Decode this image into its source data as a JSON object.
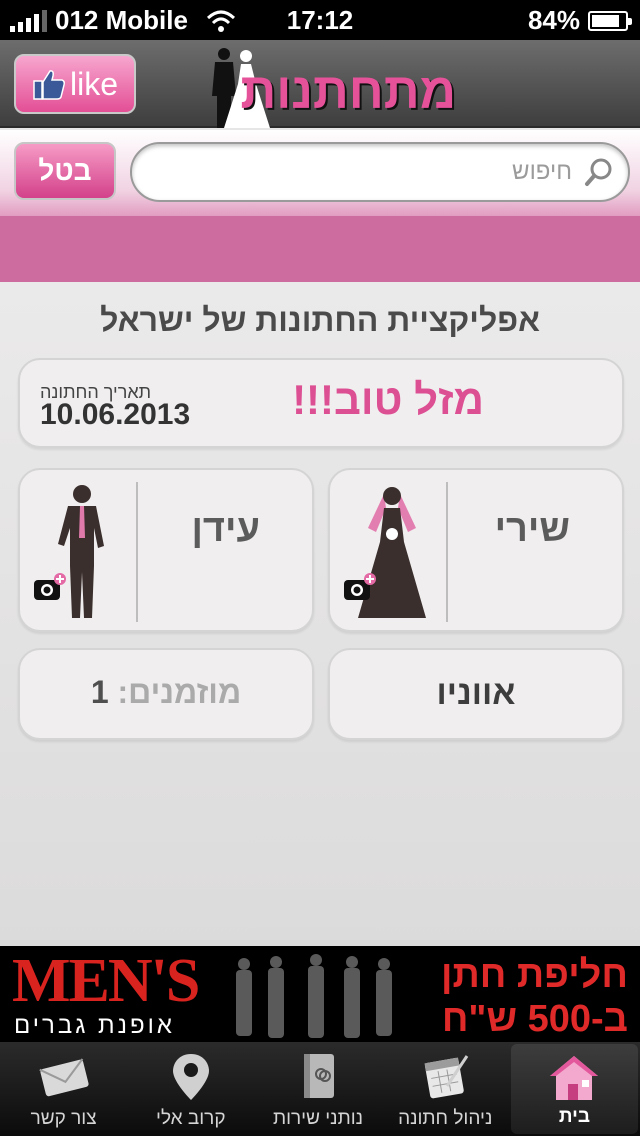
{
  "status_bar": {
    "carrier": "012 Mobile",
    "time": "17:12",
    "battery": "84%",
    "battery_level": 0.84
  },
  "header": {
    "like_label": "like",
    "logo_text": "מתחתנות"
  },
  "search": {
    "placeholder": "חיפוש",
    "cancel_label": "בטל"
  },
  "main": {
    "app_title": "אפליקציית החתונות של ישראל",
    "congrats": "מזל טוב!!!",
    "date_label": "תאריך החתונה",
    "date_value": "10.06.2013",
    "groom_name": "עידן",
    "bride_name": "שירי",
    "invited_label": "מוזמנים:",
    "invited_count": "1",
    "venue": "אווניו"
  },
  "banner": {
    "brand": "MEN'S",
    "brand_sub": "אופנת גברים",
    "line1": "חליפת חתן",
    "line2": "ב-500 ש\"ח"
  },
  "tabs": [
    {
      "label": "צור קשר",
      "icon": "envelope-icon"
    },
    {
      "label": "קרוב אלי",
      "icon": "map-pin-icon"
    },
    {
      "label": "נותני שירות",
      "icon": "address-book-icon"
    },
    {
      "label": "ניהול חתונה",
      "icon": "calendar-icon"
    },
    {
      "label": "בית",
      "icon": "home-icon"
    }
  ],
  "colors": {
    "accent_pink": "#e5529a",
    "band_pink": "#cd6d9f",
    "banner_red": "#e02a2a"
  }
}
